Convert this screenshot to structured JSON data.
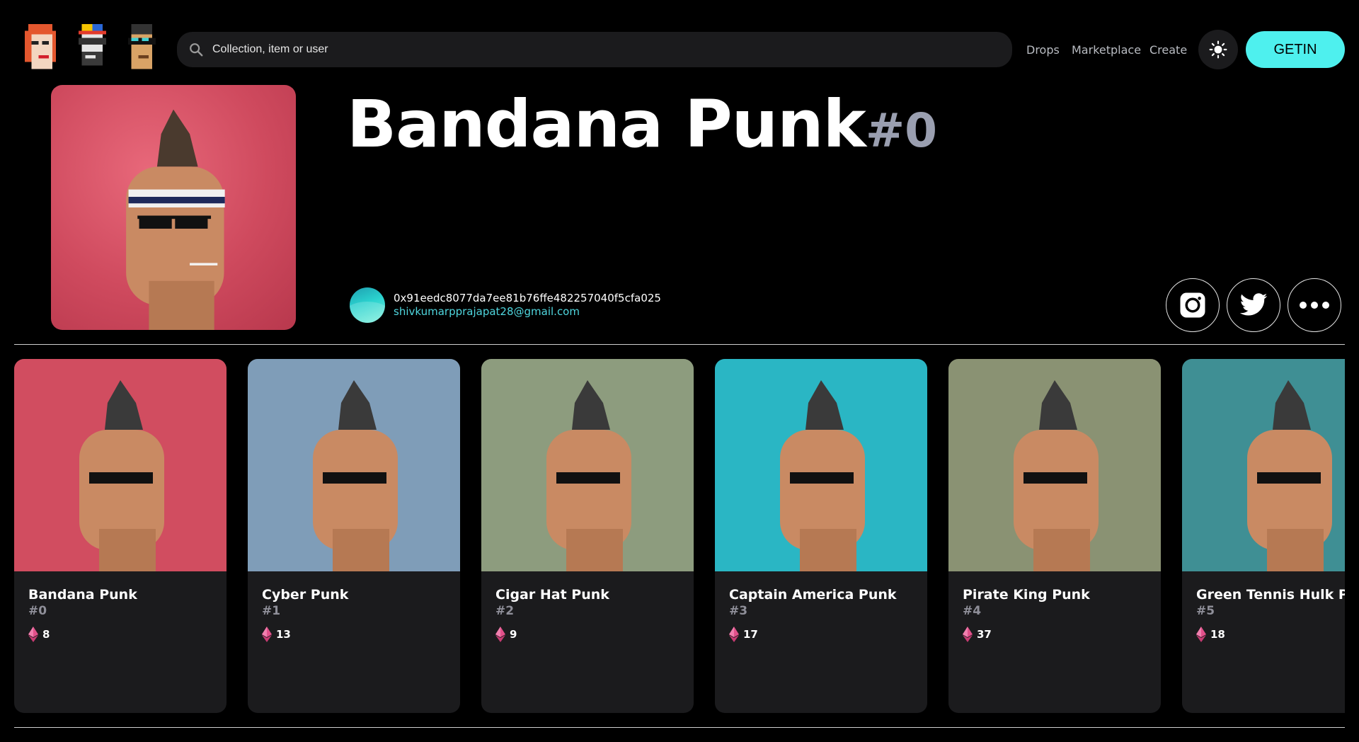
{
  "header": {
    "search_placeholder": "Collection, item or user",
    "nav": [
      {
        "label": "Drops"
      },
      {
        "label": "Marketplace"
      },
      {
        "label": "Create"
      }
    ],
    "cta_label": "GETIN",
    "icons": {
      "search": "search-icon",
      "theme": "sun-icon"
    }
  },
  "hero": {
    "title": "Bandana Punk",
    "token_id": "#0",
    "owner_address": "0x91eedc8077da7ee81b76ffe482257040f5cfa025",
    "owner_email": "shivkumarpprajapat28@gmail.com",
    "social_icons": [
      "instagram-icon",
      "twitter-icon",
      "more-icon"
    ]
  },
  "colors": {
    "accent": "#4ef0ee",
    "card_bg": "#1b1b1d",
    "id_gray": "#8f8f99"
  },
  "cards": [
    {
      "name": "Bandana Punk",
      "id": "#0",
      "price": "8",
      "bg": "#d14d60"
    },
    {
      "name": "Cyber Punk",
      "id": "#1",
      "price": "13",
      "bg": "#7f9db8"
    },
    {
      "name": "Cigar Hat Punk",
      "id": "#2",
      "price": "9",
      "bg": "#8d9c7e"
    },
    {
      "name": "Captain America Punk",
      "id": "#3",
      "price": "17",
      "bg": "#2ab6c4"
    },
    {
      "name": "Pirate King Punk",
      "id": "#4",
      "price": "37",
      "bg": "#8a9273"
    },
    {
      "name": "Green Tennis Hulk Punk",
      "id": "#5",
      "price": "18",
      "bg": "#3f8f94"
    }
  ]
}
